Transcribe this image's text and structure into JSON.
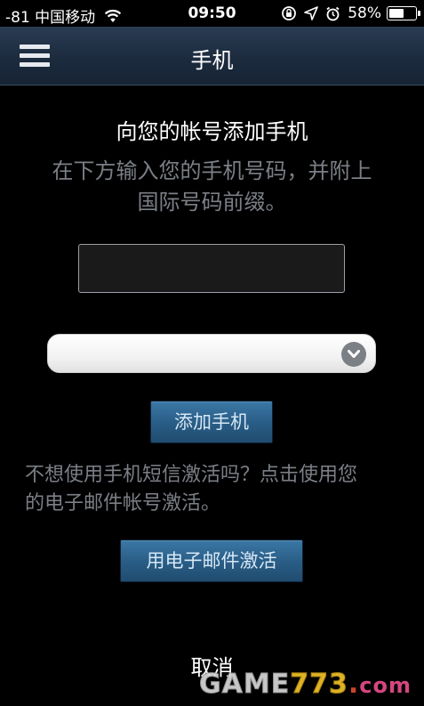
{
  "status_bar": {
    "carrier": "-81 中国移动",
    "time": "09:50",
    "battery_text": "58%",
    "battery_level": 0.58,
    "icons": [
      "wifi-icon",
      "rotation-lock-icon",
      "location-arrow-icon",
      "alarm-icon",
      "battery-icon"
    ]
  },
  "nav": {
    "title": "手机",
    "menu_icon": "hamburger-menu-icon"
  },
  "main": {
    "heading": "向您的帐号添加手机",
    "instructions_line1": "在下方输入您的手机号码，并附上",
    "instructions_line2": "国际号码前缀。",
    "phone_input_value": "",
    "phone_input_placeholder": "",
    "country_select_value": "",
    "select_icon": "chevron-down-icon",
    "add_phone_label": "添加手机",
    "sms_note_line1": "不想使用手机短信激活吗？点击使用您",
    "sms_note_line2": "的电子邮件帐号激活。",
    "email_activate_label": "用电子邮件激活",
    "cancel_label": "取消"
  },
  "watermark": {
    "text_game": "GAME",
    "text_num": "773",
    "text_dot": ".",
    "text_com": "com"
  },
  "colors": {
    "nav_bar": "#1c2b3e",
    "button_blue": "#2a5e87",
    "muted_text": "#7b7f86",
    "background": "#000000"
  }
}
